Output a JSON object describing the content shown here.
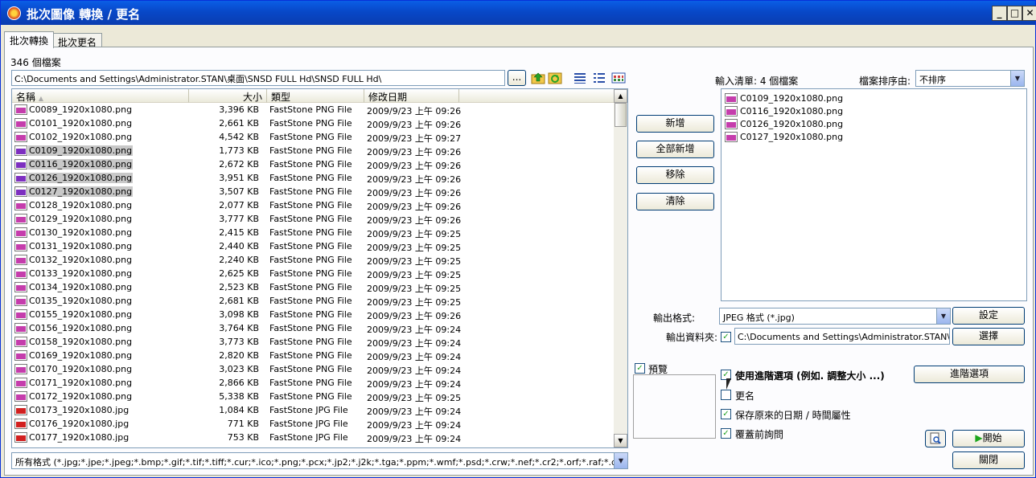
{
  "window": {
    "title": "批次圖像 轉換 / 更名"
  },
  "tabs": [
    "批次轉換",
    "批次更名"
  ],
  "file_count": "346 個檔案",
  "path": "C:\\Documents and Settings\\Administrator.STAN\\桌面\\SNSD  FULL Hd\\SNSD  FULL Hd\\",
  "browse_label": "...",
  "columns": {
    "name": "名稱",
    "size": "大小",
    "type": "類型",
    "date": "修改日期"
  },
  "files": [
    {
      "name": "C0089_1920x1080.png",
      "size": "3,396 KB",
      "type": "FastStone PNG File",
      "date": "2009/9/23 上午 09:26",
      "ext": "png",
      "sel": false
    },
    {
      "name": "C0101_1920x1080.png",
      "size": "2,661 KB",
      "type": "FastStone PNG File",
      "date": "2009/9/23 上午 09:26",
      "ext": "png",
      "sel": false
    },
    {
      "name": "C0102_1920x1080.png",
      "size": "4,542 KB",
      "type": "FastStone PNG File",
      "date": "2009/9/23 上午 09:27",
      "ext": "png",
      "sel": false
    },
    {
      "name": "C0109_1920x1080.png",
      "size": "1,773 KB",
      "type": "FastStone PNG File",
      "date": "2009/9/23 上午 09:26",
      "ext": "png",
      "sel": true
    },
    {
      "name": "C0116_1920x1080.png",
      "size": "2,672 KB",
      "type": "FastStone PNG File",
      "date": "2009/9/23 上午 09:26",
      "ext": "png",
      "sel": true
    },
    {
      "name": "C0126_1920x1080.png",
      "size": "3,951 KB",
      "type": "FastStone PNG File",
      "date": "2009/9/23 上午 09:26",
      "ext": "png",
      "sel": true
    },
    {
      "name": "C0127_1920x1080.png",
      "size": "3,507 KB",
      "type": "FastStone PNG File",
      "date": "2009/9/23 上午 09:26",
      "ext": "png",
      "sel": true
    },
    {
      "name": "C0128_1920x1080.png",
      "size": "2,077 KB",
      "type": "FastStone PNG File",
      "date": "2009/9/23 上午 09:26",
      "ext": "png",
      "sel": false
    },
    {
      "name": "C0129_1920x1080.png",
      "size": "3,777 KB",
      "type": "FastStone PNG File",
      "date": "2009/9/23 上午 09:26",
      "ext": "png",
      "sel": false
    },
    {
      "name": "C0130_1920x1080.png",
      "size": "2,415 KB",
      "type": "FastStone PNG File",
      "date": "2009/9/23 上午 09:25",
      "ext": "png",
      "sel": false
    },
    {
      "name": "C0131_1920x1080.png",
      "size": "2,440 KB",
      "type": "FastStone PNG File",
      "date": "2009/9/23 上午 09:25",
      "ext": "png",
      "sel": false
    },
    {
      "name": "C0132_1920x1080.png",
      "size": "2,240 KB",
      "type": "FastStone PNG File",
      "date": "2009/9/23 上午 09:25",
      "ext": "png",
      "sel": false
    },
    {
      "name": "C0133_1920x1080.png",
      "size": "2,625 KB",
      "type": "FastStone PNG File",
      "date": "2009/9/23 上午 09:25",
      "ext": "png",
      "sel": false
    },
    {
      "name": "C0134_1920x1080.png",
      "size": "2,523 KB",
      "type": "FastStone PNG File",
      "date": "2009/9/23 上午 09:25",
      "ext": "png",
      "sel": false
    },
    {
      "name": "C0135_1920x1080.png",
      "size": "2,681 KB",
      "type": "FastStone PNG File",
      "date": "2009/9/23 上午 09:25",
      "ext": "png",
      "sel": false
    },
    {
      "name": "C0155_1920x1080.png",
      "size": "3,098 KB",
      "type": "FastStone PNG File",
      "date": "2009/9/23 上午 09:26",
      "ext": "png",
      "sel": false
    },
    {
      "name": "C0156_1920x1080.png",
      "size": "3,764 KB",
      "type": "FastStone PNG File",
      "date": "2009/9/23 上午 09:24",
      "ext": "png",
      "sel": false
    },
    {
      "name": "C0158_1920x1080.png",
      "size": "3,773 KB",
      "type": "FastStone PNG File",
      "date": "2009/9/23 上午 09:24",
      "ext": "png",
      "sel": false
    },
    {
      "name": "C0169_1920x1080.png",
      "size": "2,820 KB",
      "type": "FastStone PNG File",
      "date": "2009/9/23 上午 09:24",
      "ext": "png",
      "sel": false
    },
    {
      "name": "C0170_1920x1080.png",
      "size": "3,023 KB",
      "type": "FastStone PNG File",
      "date": "2009/9/23 上午 09:24",
      "ext": "png",
      "sel": false
    },
    {
      "name": "C0171_1920x1080.png",
      "size": "2,866 KB",
      "type": "FastStone PNG File",
      "date": "2009/9/23 上午 09:24",
      "ext": "png",
      "sel": false
    },
    {
      "name": "C0172_1920x1080.png",
      "size": "5,338 KB",
      "type": "FastStone PNG File",
      "date": "2009/9/23 上午 09:25",
      "ext": "png",
      "sel": false
    },
    {
      "name": "C0173_1920x1080.jpg",
      "size": "1,084 KB",
      "type": "FastStone JPG File",
      "date": "2009/9/23 上午 09:24",
      "ext": "jpg",
      "sel": false
    },
    {
      "name": "C0176_1920x1080.jpg",
      "size": "771 KB",
      "type": "FastStone JPG File",
      "date": "2009/9/23 上午 09:24",
      "ext": "jpg",
      "sel": false
    },
    {
      "name": "C0177_1920x1080.jpg",
      "size": "753 KB",
      "type": "FastStone JPG File",
      "date": "2009/9/23 上午 09:24",
      "ext": "jpg",
      "sel": false
    }
  ],
  "filter": "所有格式 (*.jpg;*.jpe;*.jpeg;*.bmp;*.gif;*.tif;*.tiff;*.cur;*.ico;*.png;*.pcx;*.jp2;*.j2k;*.tga;*.ppm;*.wmf;*.psd;*.crw;*.nef;*.cr2;*.orf;*.raf;*.dng;*.",
  "buttons": {
    "add": "新增",
    "add_all": "全部新增",
    "remove": "移除",
    "clear": "清除"
  },
  "input_list": {
    "title": "輸入清單: 4 個檔案",
    "sort_label": "檔案排序由:",
    "sort_value": "不排序",
    "items": [
      "C0109_1920x1080.png",
      "C0116_1920x1080.png",
      "C0126_1920x1080.png",
      "C0127_1920x1080.png"
    ]
  },
  "output": {
    "format_label": "輸出格式:",
    "format_value": "JPEG 格式 (*.jpg)",
    "settings_btn": "設定",
    "folder_label": "輸出資料夾:",
    "folder_value": "C:\\Documents and Settings\\Administrator.STAN\\桌面",
    "choose_btn": "選擇"
  },
  "preview_label": "預覽",
  "options": {
    "advanced": "使用進階選項 (例如. 調整大小 ...)",
    "advanced_btn": "進階選項",
    "rename": "更名",
    "keep_date": "保存原來的日期 / 時間屬性",
    "ask_overwrite": "覆蓋前詢問"
  },
  "start_btn": "開始",
  "close_btn": "關閉"
}
